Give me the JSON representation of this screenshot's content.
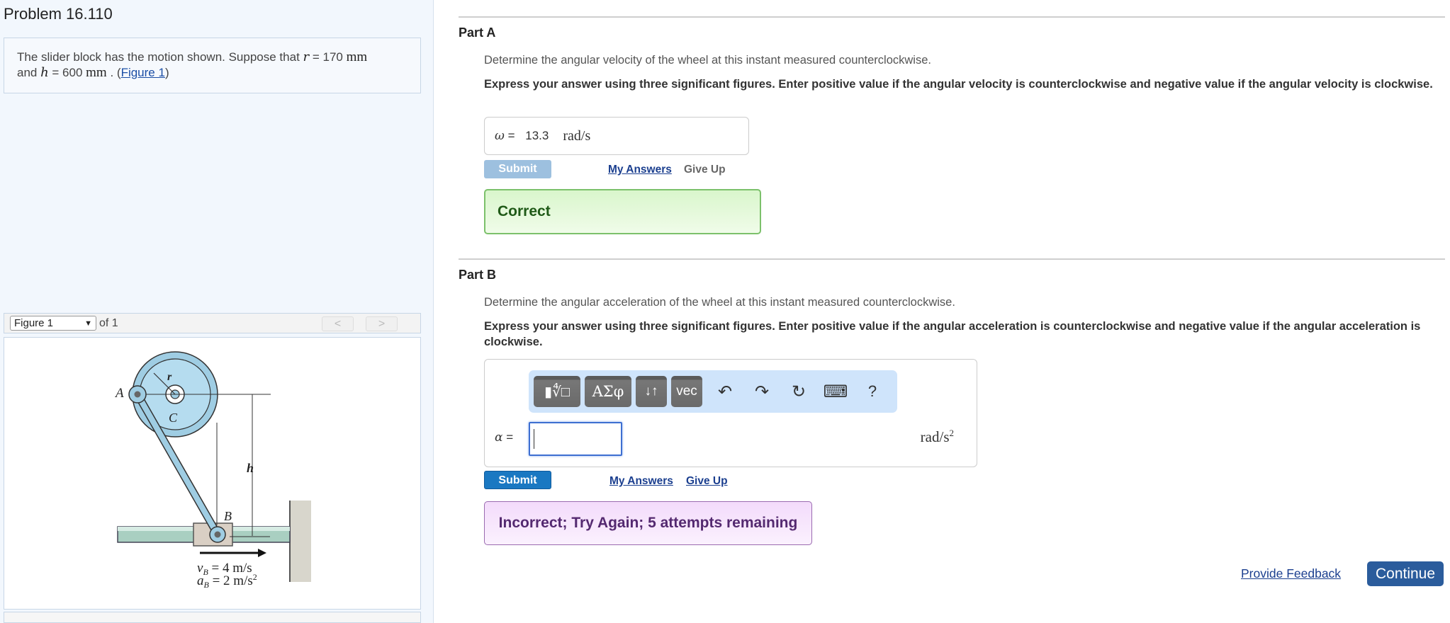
{
  "problem": {
    "title": "Problem 16.110",
    "statement_pre": "The slider block has the motion shown. Suppose that ",
    "r_symbol": "r",
    "r_value": " = 170 ",
    "r_unit": "mm",
    "and_text": "and ",
    "h_symbol": "h",
    "h_value": " = 600 ",
    "h_unit": "mm",
    "dot_open": " . (",
    "figure_link": "Figure 1",
    "close_paren": ")"
  },
  "figure": {
    "selected": "Figure 1",
    "dropdown_icon": "triangle-down",
    "of_label": "of 1",
    "prev_label": "<",
    "next_label": ">",
    "labels": {
      "A": "A",
      "B": "B",
      "C": "C",
      "r": "r",
      "h": "h",
      "vB": "v",
      "vB_sub": "B",
      "vB_val": " = 4 m/s",
      "aB": "a",
      "aB_sub": "B",
      "aB_val": " = 2 m/s",
      "aB_sup": "2"
    }
  },
  "partA": {
    "title": "Part A",
    "prompt": "Determine the angular velocity of the wheel at this instant measured counterclockwise.",
    "instruction": "Express your answer using three significant figures. Enter positive value if the angular velocity is counterclockwise and negative value if the angular velocity is clockwise.",
    "symbol": "ω",
    "equals": " = ",
    "value": "13.3",
    "unit": "rad/s",
    "submit_label": "Submit",
    "my_answers_label": "My Answers",
    "give_up_label": "Give Up",
    "feedback": "Correct"
  },
  "partB": {
    "title": "Part B",
    "prompt": "Determine the angular acceleration of the wheel at this instant measured counterclockwise.",
    "instruction": "Express your answer using three significant figures. Enter positive value if the angular acceleration is counterclockwise and negative value if the angular acceleration is clockwise.",
    "symbol": "α",
    "equals": " = ",
    "value": "",
    "unit": "rad/s",
    "unit_sup": "2",
    "toolbar": {
      "templates_label": "▮∜□",
      "greek_label": "ΑΣφ",
      "arrows_label": "↓↑",
      "vec_label": "vec",
      "undo_icon": "↶",
      "redo_icon": "↷",
      "reset_icon": "↻",
      "keyboard_icon": "⌨",
      "help_label": "?"
    },
    "submit_label": "Submit",
    "my_answers_label": "My Answers",
    "give_up_label": "Give Up",
    "feedback": "Incorrect; Try Again; 5 attempts remaining"
  },
  "footer": {
    "feedback_link": "Provide Feedback",
    "continue_label": "Continue"
  },
  "colors": {
    "correct_border": "#7cc16b",
    "incorrect_border": "#9a6bb0",
    "submit_active": "#1a78c2",
    "submit_disabled": "#9dc0df",
    "continue_bg": "#2b5c9c"
  }
}
